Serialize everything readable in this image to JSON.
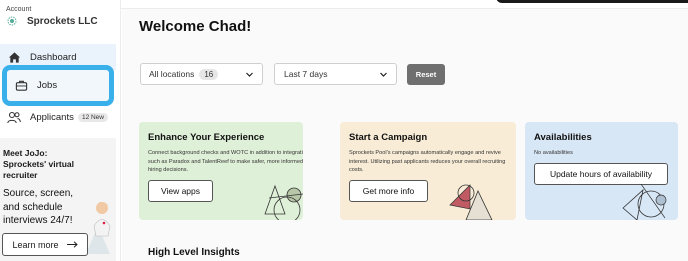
{
  "account": {
    "label": "Account",
    "name": "Sprockets LLC",
    "logo_icon": "sprocket-logo-icon"
  },
  "nav": {
    "items": [
      {
        "label": "Dashboard",
        "icon": "home-icon"
      },
      {
        "label": "Jobs",
        "icon": "briefcase-icon"
      },
      {
        "label": "Applicants",
        "icon": "people-icon",
        "badge": "12 New"
      }
    ]
  },
  "promo": {
    "title": "Meet JoJo: Sprockets' virtual recruiter",
    "body": "Source, screen, and schedule interviews 24/7!",
    "button_label": "Learn more",
    "button_icon": "arrow-right-icon"
  },
  "main": {
    "welcome": "Welcome Chad!",
    "filters": {
      "location_label": "All locations",
      "location_count": "16",
      "date_label": "Last 7 days",
      "reset_label": "Reset"
    },
    "cards": [
      {
        "title": "Enhance Your Experience",
        "body": "Connect background checks and WOTC in addition to integrations such as Paradox and TalentReef to make safer, more informed hiring decisions.",
        "button": "View apps",
        "color": "#dff0d8"
      },
      {
        "title": "Start a Campaign",
        "body": "Sprockets Pool's campaigns automatically engage and revive interest. Utilizing past applicants reduces your overall recruiting costs.",
        "button": "Get more info",
        "color": "#f8ecd6"
      },
      {
        "title": "Availabilities",
        "body": "No availabilities",
        "button": "Update hours of availability",
        "color": "#d8e7f6"
      }
    ],
    "section_title": "High Level Insights"
  },
  "colors": {
    "accent_outline": "#3ab0ea",
    "reset_button": "#6f6f6f"
  }
}
